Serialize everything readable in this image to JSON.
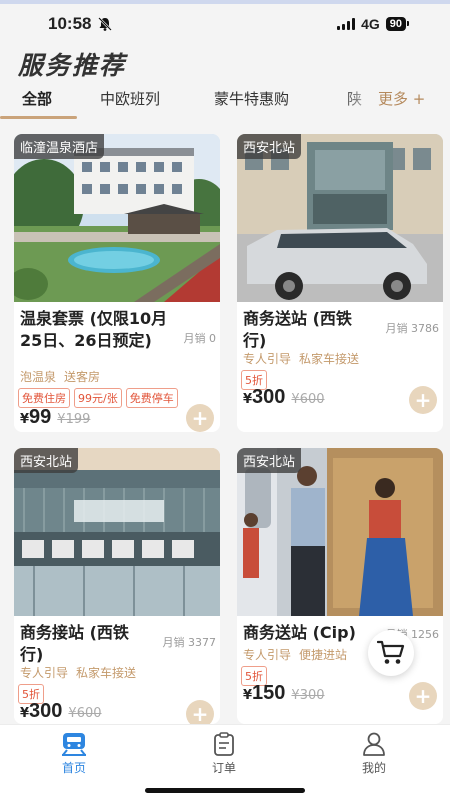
{
  "status": {
    "time": "10:58",
    "network": "4G",
    "battery": "90"
  },
  "page_title": "服务推荐",
  "tabs": [
    {
      "label": "全部"
    },
    {
      "label": "中欧班列"
    },
    {
      "label": "蒙牛特惠购"
    },
    {
      "label": "陕"
    }
  ],
  "more_label": "更多 +",
  "cards": [
    {
      "tag": "临潼温泉酒店",
      "title": "温泉套票 (仅限10月25日、26日预定)",
      "sales": "月销 0",
      "features": [
        "泡温泉",
        "送客房"
      ],
      "chips": [
        "免费住房",
        "99元/张",
        "免费停车"
      ],
      "currency": "¥",
      "price": "99",
      "old_price": "¥199"
    },
    {
      "tag": "西安北站",
      "title": "商务送站 (西铁行)",
      "sales": "月销 3786",
      "features": [
        "专人引导",
        "私家车接送"
      ],
      "chips": [
        "5折"
      ],
      "currency": "¥",
      "price": "300",
      "old_price": "¥600"
    },
    {
      "tag": "西安北站",
      "title": "商务接站 (西铁行)",
      "sales": "月销 3377",
      "features": [
        "专人引导",
        "私家车接送"
      ],
      "chips": [
        "5折"
      ],
      "currency": "¥",
      "price": "300",
      "old_price": "¥600"
    },
    {
      "tag": "西安北站",
      "title": "商务送站 (Cip)",
      "sales": "月销 1256",
      "features": [
        "专人引导",
        "便捷进站"
      ],
      "chips": [
        "5折"
      ],
      "currency": "¥",
      "price": "150",
      "old_price": "¥300"
    }
  ],
  "bottom_nav": [
    {
      "label": "首页",
      "icon": "train-home-icon"
    },
    {
      "label": "订单",
      "icon": "order-clipboard-icon"
    },
    {
      "label": "我的",
      "icon": "profile-icon"
    }
  ],
  "colors": {
    "accent": "#caa37a",
    "nav_active": "#2e86e0",
    "chip_red": "#e2553a"
  }
}
